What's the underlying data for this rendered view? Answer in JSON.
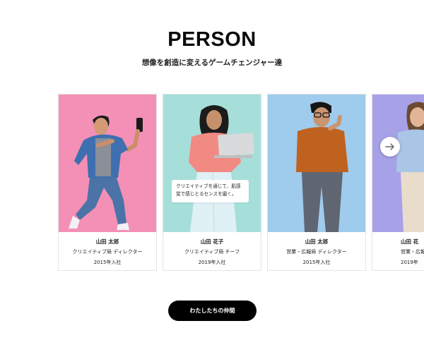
{
  "section": {
    "title": "PERSON",
    "subtitle": "想像を創造に変えるゲームチェンジャー達"
  },
  "cards": [
    {
      "name": "山田 太郎",
      "role": "クリエイティブ局 ディレクター",
      "joined": "2015年入社",
      "bg": "#f48fb5"
    },
    {
      "name": "山田 花子",
      "role": "クリエイティブ局 チーフ",
      "joined": "2019年入社",
      "bg": "#a6dfda",
      "hover_line1": "クリエイティブを通じて、肌感",
      "hover_line2": "覚で感じとるセンスを磨く。"
    },
    {
      "name": "山田 太郎",
      "role": "営業・広報局 ディレクター",
      "joined": "2015年入社",
      "bg": "#9fcbec"
    },
    {
      "name": "山田 花",
      "role": "営業・広報局",
      "joined": "2019年",
      "bg": "#a7a1e8"
    }
  ],
  "carousel": {
    "next_icon": "arrow-right-icon"
  },
  "cta": {
    "label": "わたしたちの仲間"
  }
}
